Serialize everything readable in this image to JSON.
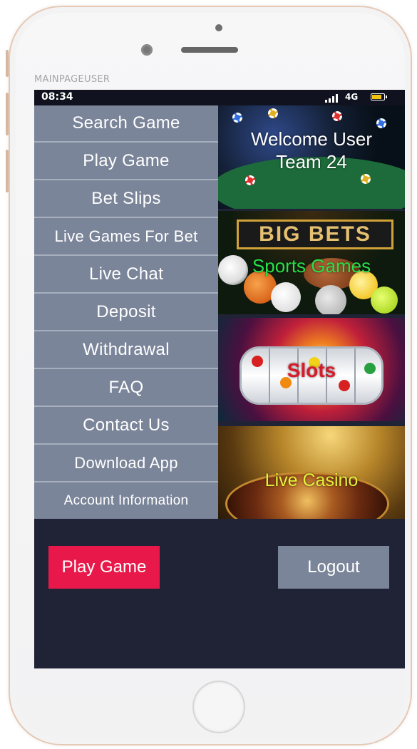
{
  "page_label": "MAINPAGEUSER",
  "status_bar": {
    "time": "08:34",
    "network": "4G"
  },
  "menu": {
    "items": [
      {
        "label": "Search Game"
      },
      {
        "label": "Play Game"
      },
      {
        "label": "Bet Slips"
      },
      {
        "label": "Live Games For Bet"
      },
      {
        "label": "Live Chat"
      },
      {
        "label": "Deposit"
      },
      {
        "label": "Withdrawal"
      },
      {
        "label": "FAQ"
      },
      {
        "label": "Contact Us"
      },
      {
        "label": "Download App"
      },
      {
        "label": "Account Information"
      }
    ]
  },
  "tiles": {
    "welcome": {
      "line1": "Welcome User",
      "line2": "Team 24",
      "color": "#ffffff"
    },
    "sports": {
      "banner": "BIG BETS",
      "label": "Sports Games",
      "color": "#27e04a"
    },
    "slots": {
      "label": "Slots",
      "color": "#d81b2a"
    },
    "casino": {
      "label": "Live Casino",
      "color": "#e4f23a"
    }
  },
  "buttons": {
    "play_label": "Play Game",
    "logout_label": "Logout"
  },
  "colors": {
    "accent": "#e8194a",
    "menu_bg": "#7b8599",
    "screen_bg": "#202336"
  }
}
